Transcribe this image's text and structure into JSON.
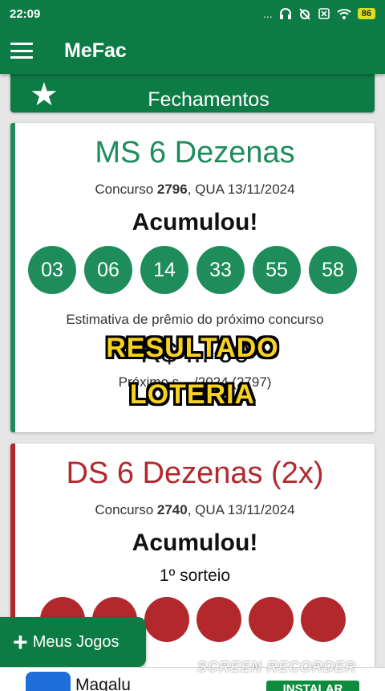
{
  "status_bar": {
    "time": "22:09",
    "dots": "...",
    "battery": "86"
  },
  "app_bar": {
    "title": "MeFac"
  },
  "fechamentos": {
    "label": "Fechamentos"
  },
  "cards": {
    "ms": {
      "title": "MS 6 Dezenas",
      "concurso_prefix": "Concurso ",
      "concurso_number": "2796",
      "concurso_suffix": ", QUA 13/11/2024",
      "status": "Acumulou!",
      "numbers": [
        "03",
        "06",
        "14",
        "33",
        "55",
        "58"
      ],
      "estimativa": "Estimativa de prêmio do próximo concurso",
      "premio_visible": "R$ ... 00",
      "proximo_visible": "Próximo s... /2024 (2797)",
      "accent": "#1e8c5b"
    },
    "ds": {
      "title": "DS 6 Dezenas (2x)",
      "concurso_prefix": "Concurso ",
      "concurso_number": "2740",
      "concurso_suffix": ", QUA 13/11/2024",
      "status": "Acumulou!",
      "sorteio": "1º sorteio",
      "accent": "#b3282d"
    }
  },
  "overlay_text": {
    "line1": "RESULTADO",
    "line2": "LOTERIA"
  },
  "fab": {
    "label": "Meus Jogos"
  },
  "ad": {
    "name": "Magalu",
    "install": "INSTALAR"
  },
  "watermark": "SCREEN RECORDER"
}
